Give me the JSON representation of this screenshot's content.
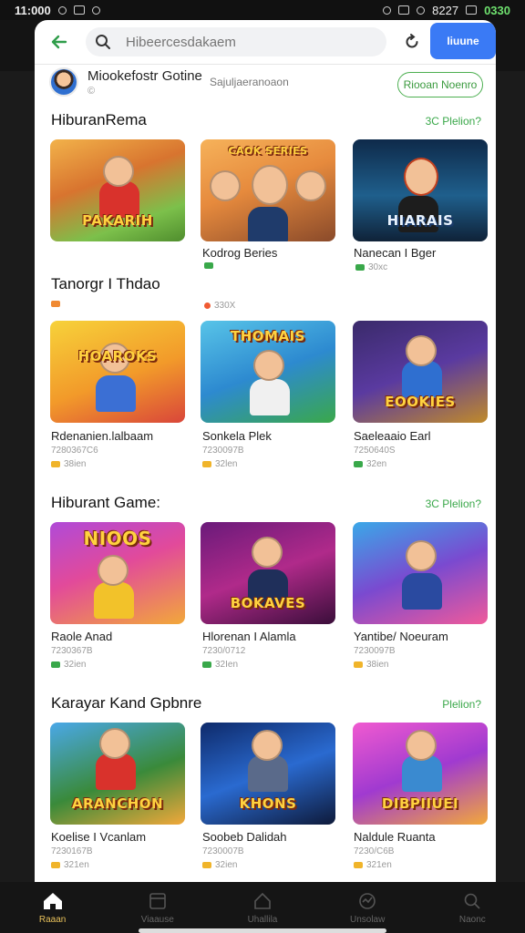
{
  "status_bar": {
    "time": "11:000",
    "battery": "0330",
    "carrier": "8227"
  },
  "search": {
    "placeholder": "Hibeercesdakaem",
    "button_label": "Iiuune"
  },
  "profile": {
    "name": "Miookefostr Gotine",
    "sub": "©",
    "handle": "Sajuljaeranoaon",
    "follow_label": "Riooan Noenro"
  },
  "sections": [
    {
      "title": "HiburanRema",
      "link": "3C Plelion?"
    },
    {
      "title": "Tanorgr I Thdao"
    },
    {
      "title": "Hiburant Game:",
      "link": "3C Plelion?"
    },
    {
      "title": "Karayar Kand Gpbnre",
      "link": "Plelion?"
    }
  ],
  "games": [
    {
      "tile_text": "PAKARIH",
      "title": "",
      "sub": "",
      "meta": ""
    },
    {
      "tile_text": "CAOK SERIES",
      "title": "Kodrog Beries",
      "sub": "",
      "meta": ""
    },
    {
      "tile_text": "HIARAIS",
      "title": "Nanecan I Bger",
      "sub": "",
      "meta": "30xc"
    },
    {
      "tile_text": "HOAROKS",
      "title": "Rdenanien.lalbaam",
      "sub": "7280367C6",
      "meta": "38ien"
    },
    {
      "tile_text": "THOMAIS",
      "title": "Sonkela Plek",
      "sub": "7230097B",
      "meta": "32len"
    },
    {
      "tile_text": "EOOKIES",
      "title": "Saeleaaio Earl",
      "sub": "7250640S",
      "meta": "32en"
    },
    {
      "tile_text": "NIOOS",
      "title": "Raole Anad",
      "sub": "7230367B",
      "meta": "32ien"
    },
    {
      "tile_text": "BOKAVES",
      "title": "Hlorenan I Alamla",
      "sub": "7230/0712",
      "meta": "32Ien"
    },
    {
      "tile_text": "",
      "title": "Yantibe/ Noeuram",
      "sub": "7230097B",
      "meta": "38ien"
    },
    {
      "tile_text": "ARANCHON",
      "title": "Koelise I Vcanlam",
      "sub": "7230167B",
      "meta": "321en"
    },
    {
      "tile_text": "KHONS",
      "title": "Soobeb Dalidah",
      "sub": "7230007B",
      "meta": "32ien"
    },
    {
      "tile_text": "DIBPIIUEI",
      "title": "Naldule Ruanta",
      "sub": "7230/C6B",
      "meta": "321en"
    }
  ],
  "row2_meta": [
    "",
    "330X"
  ],
  "nav": [
    "Raaan",
    "Viaause",
    "Uhallila",
    "Unsolaw",
    "Naonc"
  ],
  "colors": {
    "accent": "#3a7af5",
    "link_green": "#3aa84a",
    "nav_active": "#e8c15b"
  }
}
